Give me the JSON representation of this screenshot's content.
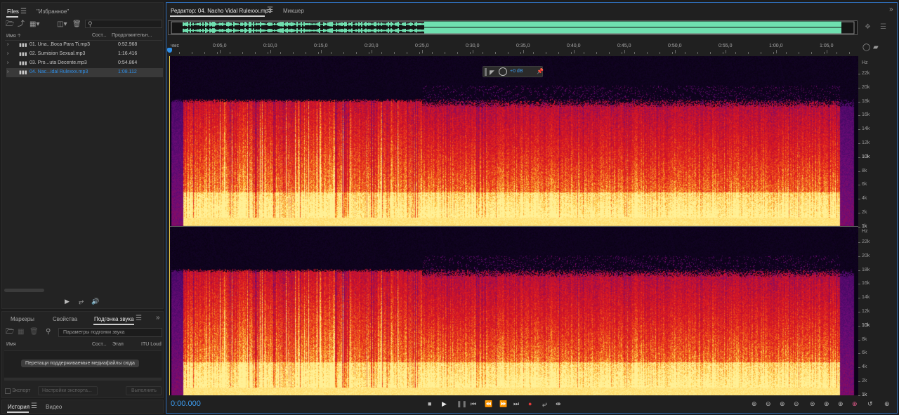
{
  "files_panel": {
    "tab_files": "Files",
    "tab_favorites": "\"Избранное\"",
    "col_name": "Имя",
    "col_state": "Сост...",
    "col_duration": "Продолжительн...",
    "files": [
      {
        "name": "01. Una...Boca Para Ti.mp3",
        "duration": "0:52.968",
        "selected": false
      },
      {
        "name": "02. Sumision Sexual.mp3",
        "duration": "1:16.416",
        "selected": false
      },
      {
        "name": "03. Pro...uta Decente.mp3",
        "duration": "0:54.864",
        "selected": false
      },
      {
        "name": "04. Nac...idal Rulexxx.mp3",
        "duration": "1:08.112",
        "selected": true
      }
    ]
  },
  "match_panel": {
    "tab_markers": "Маркеры",
    "tab_properties": "Свойства",
    "tab_match": "Подгонка звука",
    "search_placeholder": "Параметры подгонки звука",
    "col_name": "Имя",
    "col_state": "Сост...",
    "col_stage": "Этап",
    "col_itu": "ITU Loud",
    "drop_hint": "Перетащи поддерживаемые медиафайлы сюда",
    "export_label": "Экспорт",
    "export_settings": "Настройки экспорта...",
    "run_label": "Выполнить"
  },
  "bottom_left": {
    "tab_history": "История",
    "tab_video": "Видео"
  },
  "editor": {
    "tab_editor": "Редактор: 04. Nacho Vidal Rulexxx.mp3",
    "tab_mixer": "Микшер",
    "hud_gain": "+0 dB",
    "time_display": "0:00.000",
    "ruler_labels": [
      "чмс",
      "0:05,0",
      "0:10,0",
      "0:15,0",
      "0:20,0",
      "0:25,0",
      "0:30,0",
      "0:35,0",
      "0:40,0",
      "0:45,0",
      "0:50,0",
      "0:55,0",
      "1:00,0",
      "1:05,0"
    ],
    "freq_unit": "Hz",
    "freq_labels": [
      "22k",
      "20k",
      "18k",
      "16k",
      "14k",
      "12k",
      "10k",
      "8k",
      "6k",
      "4k",
      "2k",
      "1k"
    ]
  },
  "colors": {
    "accent": "#2f8fe8",
    "overview_wave": "#6fe0b0",
    "spec_dark": "#06020c",
    "spec_purple": "#5a0f79",
    "spec_red": "#d4162a",
    "spec_orange": "#f26a1a",
    "spec_yellow": "#ffd75a"
  }
}
